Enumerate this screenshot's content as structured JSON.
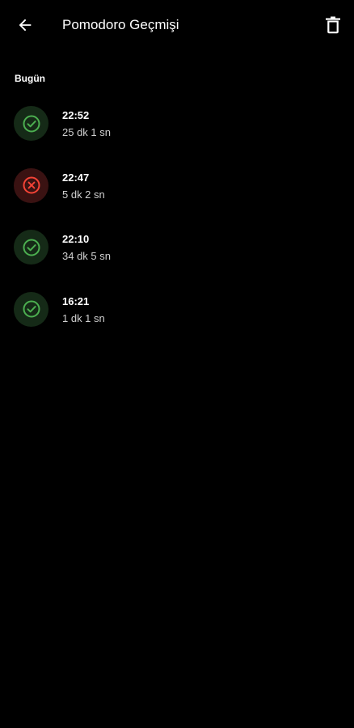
{
  "app_bar": {
    "title": "Pomodoro Geçmişi",
    "back_icon": "arrow-left-icon",
    "delete_icon": "trash-icon"
  },
  "colors": {
    "background": "#000000",
    "success": "#4caf50",
    "success_bg": "#152a17",
    "failure": "#f44336",
    "failure_bg": "#3a1212"
  },
  "section": {
    "label": "Bugün"
  },
  "history": [
    {
      "time": "22:52",
      "duration": "25 dk 1 sn",
      "status": "completed",
      "icon": "check-circle-icon"
    },
    {
      "time": "22:47",
      "duration": "5 dk 2 sn",
      "status": "cancelled",
      "icon": "x-circle-icon"
    },
    {
      "time": "22:10",
      "duration": "34 dk 5 sn",
      "status": "completed",
      "icon": "check-circle-icon"
    },
    {
      "time": "16:21",
      "duration": "1 dk 1 sn",
      "status": "completed",
      "icon": "check-circle-icon"
    }
  ]
}
